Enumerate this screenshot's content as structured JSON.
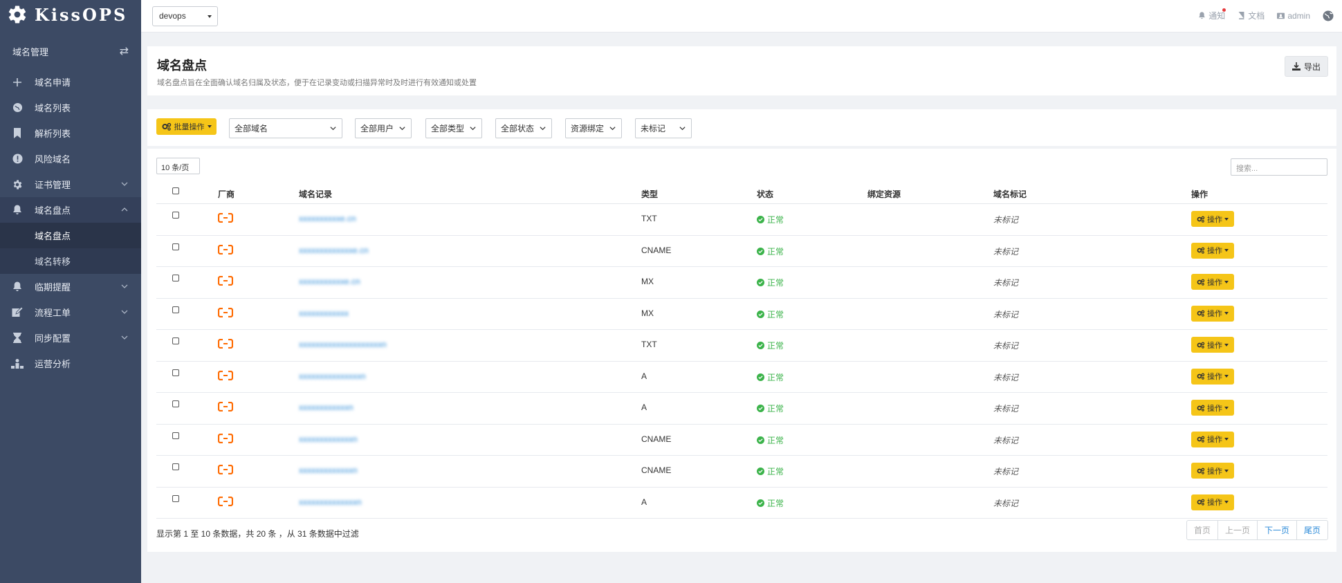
{
  "app": {
    "brand": "KissOPS"
  },
  "topbar": {
    "env_value": "devops",
    "notify_label": "通知",
    "docs_label": "文档",
    "user_label": "admin"
  },
  "sidebar": {
    "section_title": "域名管理",
    "items": [
      {
        "label": "域名申请",
        "icon": "plus-icon"
      },
      {
        "label": "域名列表",
        "icon": "globe-icon"
      },
      {
        "label": "解析列表",
        "icon": "bookmark-icon"
      },
      {
        "label": "风险域名",
        "icon": "alert-icon"
      },
      {
        "label": "证书管理",
        "icon": "gear-icon"
      },
      {
        "label": "域名盘点",
        "icon": "bell-icon"
      },
      {
        "label": "临期提醒",
        "icon": "bell-icon"
      },
      {
        "label": "流程工单",
        "icon": "edit-icon"
      },
      {
        "label": "同步配置",
        "icon": "hourglass-icon"
      },
      {
        "label": "运营分析",
        "icon": "chart-icon"
      }
    ],
    "subitems": [
      "域名盘点",
      "域名转移"
    ]
  },
  "header": {
    "title": "域名盘点",
    "description": "域名盘点旨在全面确认域名归属及状态，便于在记录变动或扫描异常时及时进行有效通知或处置",
    "export_label": "导出"
  },
  "filters": {
    "batch_label": "批量操作",
    "domain": "全部域名",
    "user": "全部用户",
    "type": "全部类型",
    "status": "全部状态",
    "binding": "资源绑定",
    "mark": "未标记"
  },
  "table": {
    "page_size": "10 条/页",
    "search_placeholder": "搜索...",
    "columns": [
      "厂商",
      "域名记录",
      "类型",
      "状态",
      "绑定资源",
      "域名标记",
      "操作"
    ],
    "rows": [
      {
        "domain": "xxxxxxxxxxe.cn",
        "type": "TXT",
        "status": "正常",
        "tag": "未标记",
        "op": "操作"
      },
      {
        "domain": "xxxxxxxxxxxxxe.cn",
        "type": "CNAME",
        "status": "正常",
        "tag": "未标记",
        "op": "操作"
      },
      {
        "domain": "xxxxxxxxxxxe.cn",
        "type": "MX",
        "status": "正常",
        "tag": "未标记",
        "op": "操作"
      },
      {
        "domain": "xxxxxxxxxxxx",
        "type": "MX",
        "status": "正常",
        "tag": "未标记",
        "op": "操作"
      },
      {
        "domain": "xxxxxxxxxxxxxxxxxxxxn",
        "type": "TXT",
        "status": "正常",
        "tag": "未标记",
        "op": "操作"
      },
      {
        "domain": "xxxxxxxxxxxxxxxn",
        "type": "A",
        "status": "正常",
        "tag": "未标记",
        "op": "操作"
      },
      {
        "domain": "xxxxxxxxxxxxn",
        "type": "A",
        "status": "正常",
        "tag": "未标记",
        "op": "操作"
      },
      {
        "domain": "xxxxxxxxxxxxxn",
        "type": "CNAME",
        "status": "正常",
        "tag": "未标记",
        "op": "操作"
      },
      {
        "domain": "xxxxxxxxxxxxxn",
        "type": "CNAME",
        "status": "正常",
        "tag": "未标记",
        "op": "操作"
      },
      {
        "domain": "xxxxxxxxxxxxxxn",
        "type": "A",
        "status": "正常",
        "tag": "未标记",
        "op": "操作"
      }
    ],
    "summary": "显示第 1 至 10 条数据，共 20 条 ，从 31 条数据中过滤",
    "pager": [
      "首页",
      "上一页",
      "下一页",
      "尾页"
    ]
  },
  "colors": {
    "sidebar_bg": "#3c4a64",
    "accent_yellow": "#f5c518",
    "link_blue": "#2b8ad8",
    "ok_green": "#3bb34a",
    "vendor_orange": "#ff6a00"
  }
}
